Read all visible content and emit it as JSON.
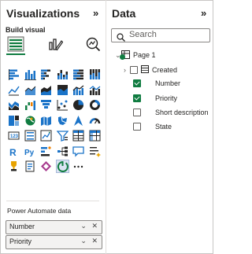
{
  "visualizations": {
    "title": "Visualizations",
    "collapse_icon": "»",
    "build_visual_label": "Build visual",
    "top_icons": [
      "build-visual-icon",
      "format-visual-icon",
      "analytics-icon"
    ],
    "visual_types": [
      "stacked-bar-chart",
      "stacked-column-chart",
      "clustered-bar-chart",
      "clustered-column-chart",
      "100-stacked-bar-chart",
      "100-stacked-column-chart",
      "line-chart",
      "area-chart",
      "stacked-area-chart",
      "100-stacked-area-chart",
      "line-and-stacked-column-chart",
      "line-and-clustered-column-chart",
      "ribbon-chart",
      "waterfall-chart",
      "funnel-chart",
      "scatter-chart",
      "pie-chart",
      "donut-chart",
      "treemap",
      "map",
      "filled-map",
      "shape-map",
      "azure-map",
      "gauge",
      "card",
      "multi-row-card",
      "kpi",
      "slicer",
      "table",
      "matrix",
      "r-script-visual",
      "python-visual",
      "key-influencers",
      "decomposition-tree",
      "qa-visual",
      "smart-narrative",
      "metrics",
      "paginated-report",
      "power-apps",
      "power-automate",
      "more-visuals"
    ],
    "power_automate": {
      "title": "Power Automate data",
      "fields": [
        {
          "label": "Number"
        },
        {
          "label": "Priority"
        }
      ],
      "field_controls": "⌄ ✕"
    }
  },
  "data": {
    "title": "Data",
    "collapse_icon": "»",
    "search_placeholder": "Search",
    "page": {
      "label": "Page 1"
    },
    "table": {
      "label": "Created"
    },
    "fields": [
      {
        "label": "Number",
        "checked": true
      },
      {
        "label": "Priority",
        "checked": true
      },
      {
        "label": "Short description",
        "checked": false
      },
      {
        "label": "State",
        "checked": false
      }
    ]
  },
  "colors": {
    "accent": "#107c41",
    "brand_blue": "#118dff",
    "dark_navy": "#252423"
  }
}
